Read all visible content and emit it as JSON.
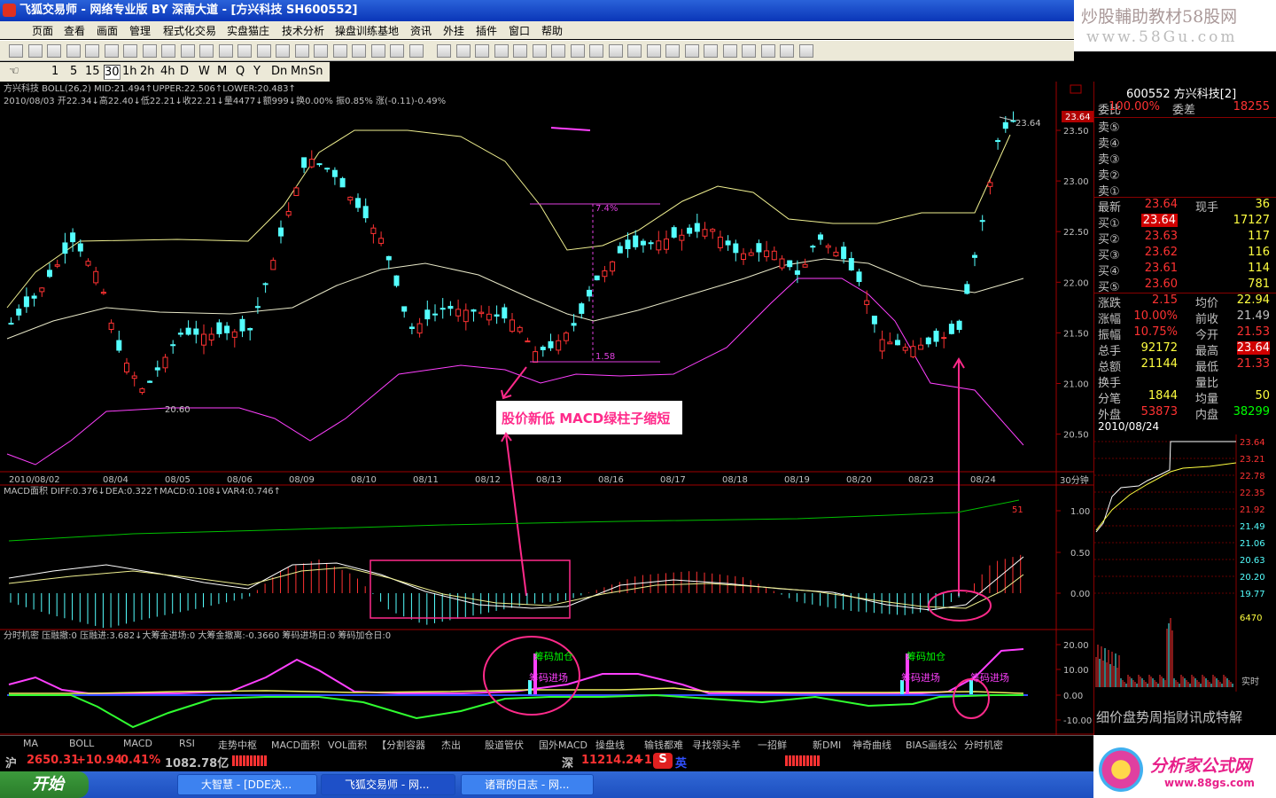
{
  "window": {
    "title": "飞狐交易师 - 网络专业版 BY 深南大道 - [方兴科技 SH600552]"
  },
  "watermark_top": {
    "line1": "炒股輔助教材58股网",
    "line2": "www.58Gu.com"
  },
  "menu": [
    "页面",
    "查看",
    "画面",
    "管理",
    "程式化交易",
    "实盘猫庄",
    "技术分析",
    "操盘训练基地",
    "资讯",
    "外挂",
    "插件",
    "窗口",
    "帮助"
  ],
  "periods": [
    "1",
    "5",
    "15",
    "30",
    "1h",
    "2h",
    "4h",
    "D",
    "W",
    "M",
    "Q",
    "Y",
    "Dn",
    "Mn",
    "Sn"
  ],
  "main": {
    "header1": "方兴科技 BOLL(26,2) MID:21.494↑UPPER:22.506↑LOWER:20.483↑",
    "header2": "2010/08/03 开22.34↓高22.40↓低22.21↓收22.21↓量4477↓额999↓换0.00% 振0.85% 涨(-0.11)-0.49%",
    "y_labels": [
      "23.50",
      "23.00",
      "22.50",
      "22.00",
      "21.50",
      "21.00",
      "20.50"
    ],
    "date_labels": [
      "2010/08/02",
      "08/04",
      "08/05",
      "08/06",
      "08/09",
      "08/10",
      "08/11",
      "08/12",
      "08/13",
      "08/16",
      "08/17",
      "08/18",
      "08/19",
      "08/20",
      "08/23",
      "08/24"
    ],
    "period_label": "30分钟",
    "price_high_label": "23.64",
    "current_price_tag": "23.64",
    "low_label": "20.60",
    "measure_top": "7.4%",
    "measure_bottom": "1.58",
    "annotation": "股价新低 MACD绿柱子缩短"
  },
  "macd": {
    "header": "MACD面积 DIFF:0.376↓DEA:0.322↑MACD:0.108↓VAR4:0.746↑",
    "y_labels": [
      "1.00",
      "0.50",
      "0.00"
    ],
    "right_tag": "51"
  },
  "timing": {
    "header": "分时机密 压融撤:0 压融进:3.682↓大筹金进场:0 大筹金撤离:-0.3660 筹码进场日:0 筹码加仓日:0",
    "y_labels": [
      "20.00",
      "10.00",
      "0.00",
      "-10.00"
    ],
    "lbl_add": "筹码加仓",
    "lbl_in": "筹码进场"
  },
  "tabs": [
    "MA",
    "BOLL",
    "MACD",
    "RSI",
    "走势中枢",
    "MACD面积",
    "VOL面积",
    "【分割容器",
    "杰出",
    "股道管伏",
    "国外MACD",
    "操盘线",
    "输钱都难",
    "寻找领头羊",
    "一招鲜",
    "新DMI",
    "神奇曲线",
    "BIAS画线公",
    "分时机密"
  ],
  "quote": {
    "title": "600552 方兴科技[2]",
    "weibi": {
      "label": "委比",
      "pct": "100.00%",
      "label2": "委差",
      "val": "18255"
    },
    "sells": [
      "卖⑤",
      "卖④",
      "卖③",
      "卖②",
      "卖①"
    ],
    "latest": {
      "label": "最新",
      "val": "23.64",
      "label2": "现手",
      "val2": "36"
    },
    "buys": [
      {
        "label": "买①",
        "price": "23.64",
        "vol": "17127"
      },
      {
        "label": "买②",
        "price": "23.63",
        "vol": "117"
      },
      {
        "label": "买③",
        "price": "23.62",
        "vol": "116"
      },
      {
        "label": "买④",
        "price": "23.61",
        "vol": "114"
      },
      {
        "label": "买⑤",
        "price": "23.60",
        "vol": "781"
      }
    ],
    "stats": [
      {
        "l": "涨跌",
        "v": "2.15",
        "l2": "均价",
        "v2": "22.94"
      },
      {
        "l": "涨幅",
        "v": "10.00%",
        "l2": "前收",
        "v2": "21.49"
      },
      {
        "l": "振幅",
        "v": "10.75%",
        "l2": "今开",
        "v2": "21.53"
      },
      {
        "l": "总手",
        "v": "92172",
        "l2": "最高",
        "v2": "23.64"
      },
      {
        "l": "总额",
        "v": "21144",
        "l2": "最低",
        "v2": "21.33"
      },
      {
        "l": "换手",
        "v": "",
        "l2": "量比",
        "v2": ""
      },
      {
        "l": "分笔",
        "v": "1844",
        "l2": "均量",
        "v2": "50"
      },
      {
        "l": "外盘",
        "v": "53873",
        "l2": "内盘",
        "v2": "38299"
      }
    ],
    "date": "2010/08/24",
    "mini_y": [
      "23.64",
      "23.21",
      "22.78",
      "22.35",
      "21.92",
      "21.49",
      "21.06",
      "20.63",
      "20.20",
      "19.77"
    ],
    "vol_top": "6470",
    "realtime": "实时",
    "bottom_tabs": "细价盘势周指财讯成特解"
  },
  "status": {
    "sh_label": "沪",
    "sh_index": "2650.31",
    "sh_change": "+10.94",
    "sh_pct": "0.41%",
    "sh_amount": "1082.78亿",
    "sz_label": "深",
    "sz_index": "11214.24",
    "sz_change": "+1"
  },
  "taskbar": {
    "start": "开始",
    "tasks": [
      "大智慧 - [DDE决...",
      "飞狐交易师 - 网...",
      "诸哥的日志 - 网..."
    ],
    "ime": "英"
  },
  "logo": {
    "text": "分析家公式网",
    "url": "www.88gs.com"
  },
  "colors": {
    "up": "#ff3232",
    "down": "#54ffff",
    "mid": "#e8e8c8",
    "upper": "#f0f090",
    "lower": "#ff40ff",
    "annot": "#ff2a8a"
  }
}
